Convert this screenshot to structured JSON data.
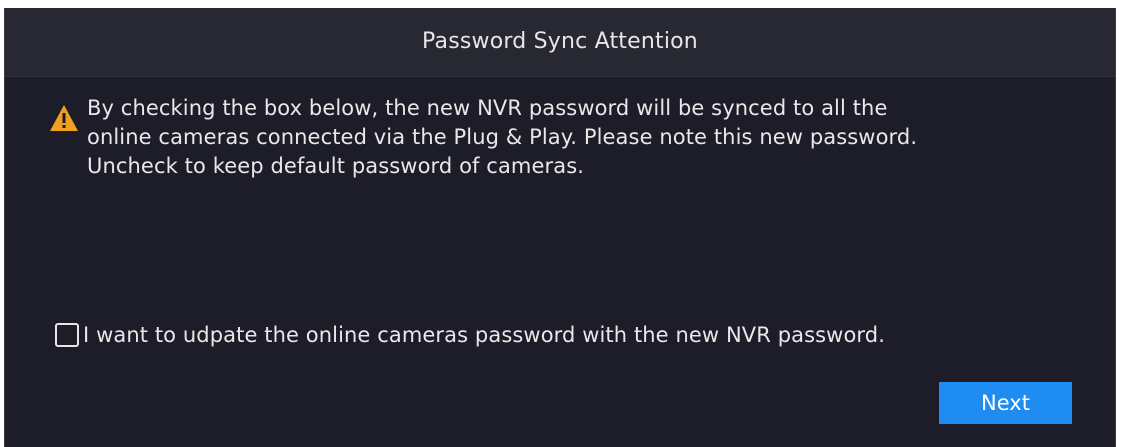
{
  "dialog": {
    "title": "Password Sync Attention",
    "message_lines": [
      "By checking the box below, the new NVR password will be synced to all the",
      "online cameras connected via the Plug & Play. Please note this new password.",
      "Uncheck to keep default password of cameras."
    ],
    "checkbox": {
      "label": "I want to udpate the online cameras password with the new NVR password.",
      "checked": false
    },
    "next_label": "Next"
  },
  "colors": {
    "dialog_background": "#1c1d28",
    "titlebar_background": "#272832",
    "accent": "#1e8cf0",
    "warning": "#f0a020"
  },
  "icons": {
    "warning": "warning-triangle-icon"
  }
}
